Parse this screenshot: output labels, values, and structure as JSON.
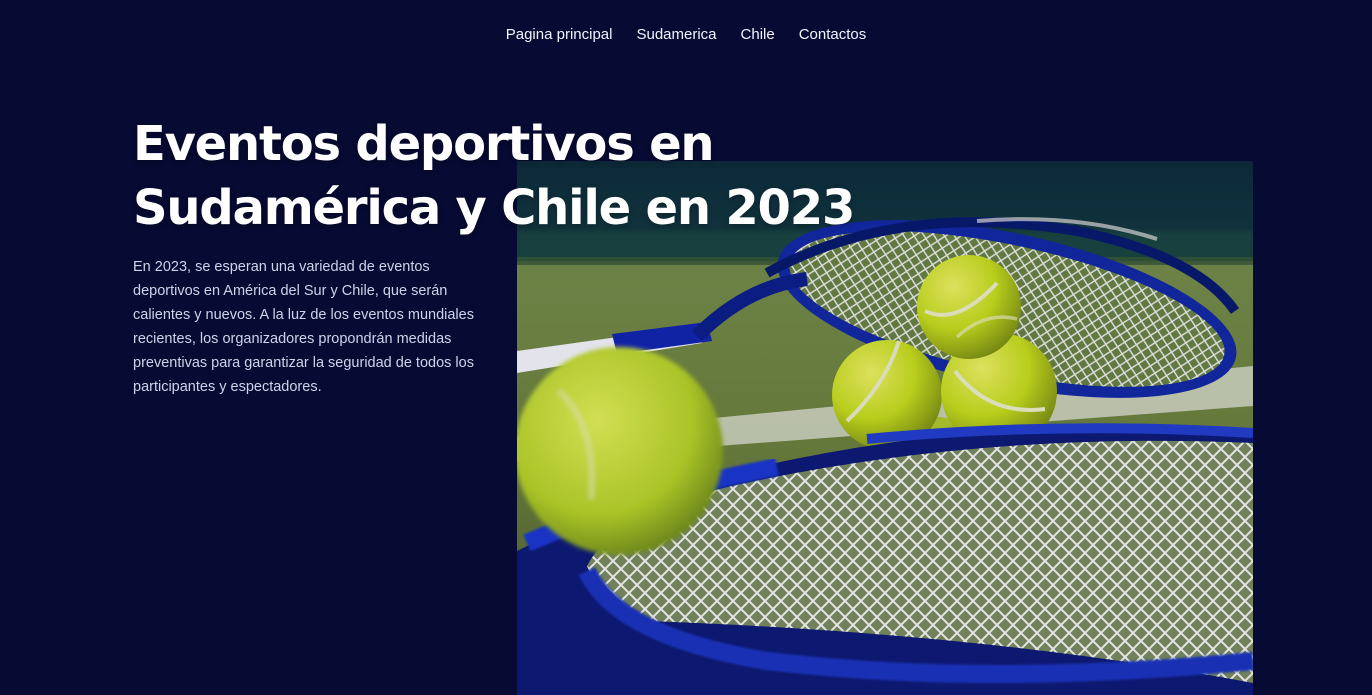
{
  "nav": {
    "items": [
      {
        "label": "Pagina principal"
      },
      {
        "label": "Sudamerica"
      },
      {
        "label": "Chile"
      },
      {
        "label": "Contactos"
      }
    ]
  },
  "hero": {
    "title_line_1": "Eventos deportivos en",
    "title_line_2": "Sudamérica y Chile en 2023",
    "intro": "En 2023, se esperan una variedad de eventos deportivos en América del Sur y Chile, que serán calientes y nuevos. A la luz de los eventos mundiales recientes, los organizadores propondrán medidas preventivas para garantizar la seguridad de todos los participantes y espectadores."
  },
  "colors": {
    "background": "#070a32",
    "text": "#ffffff",
    "muted_text": "#cfd3ea",
    "racket_blue": "#1e32b8",
    "ball_yellow": "#c8df1f"
  }
}
